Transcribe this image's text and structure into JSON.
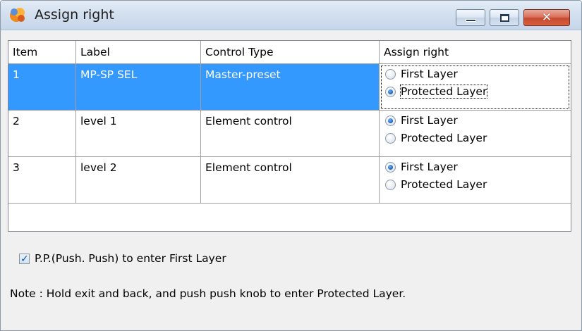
{
  "window": {
    "title": "Assign right",
    "app_icon": "app-logo-icon",
    "close_glyph": "✕"
  },
  "table": {
    "columns": [
      "Item",
      "Label",
      "Control Type",
      "Assign right"
    ],
    "rows": [
      {
        "item": "1",
        "label": "MP-SP SEL",
        "control_type": "Master-preset",
        "options": [
          "First Layer",
          "Protected Layer"
        ],
        "selected_option": "Protected Layer",
        "row_selected": true
      },
      {
        "item": "2",
        "label": "level 1",
        "control_type": "Element control",
        "options": [
          "First Layer",
          "Protected Layer"
        ],
        "selected_option": "First Layer",
        "row_selected": false
      },
      {
        "item": "3",
        "label": "level 2",
        "control_type": "Element control",
        "options": [
          "First Layer",
          "Protected Layer"
        ],
        "selected_option": "First Layer",
        "row_selected": false
      }
    ]
  },
  "checkbox": {
    "label": "P.P.(Push. Push) to enter First Layer",
    "checked": true
  },
  "note": "Note : Hold exit and back, and push push knob to enter Protected Layer.",
  "colors": {
    "selection": "#3399ff",
    "selection_text": "#ffffff",
    "window_bg": "#f0f0f0"
  }
}
